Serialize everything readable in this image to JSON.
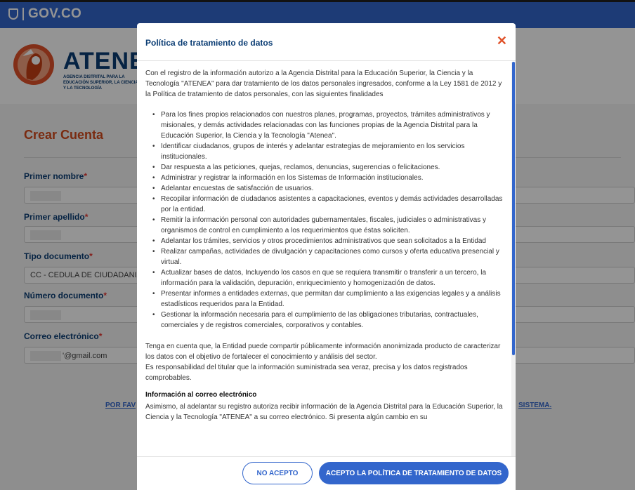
{
  "gov_bar": {
    "logo_text": "GOV.CO",
    "color": "#3366cc"
  },
  "brand": {
    "name": "ATENEA",
    "subtitle": "AGENCIA DISTRITAL PARA LA EDUCACIÓN SUPERIOR, LA CIENCIA Y LA TECNOLOGÍA",
    "primary_color": "#0b3d74",
    "accent_color": "#e0522a"
  },
  "form": {
    "title": "Crear Cuenta",
    "fields": [
      {
        "label": "Primer nombre",
        "value": ""
      },
      {
        "label": "Primer apellido",
        "value": ""
      },
      {
        "label": "Tipo documento",
        "value": "CC - CEDULA DE CIUDADANIA"
      },
      {
        "label": "Número documento",
        "value": ""
      },
      {
        "label": "Correo electrónico",
        "value": "'@gmail.com"
      }
    ],
    "required_mark": "*",
    "link_left": "POR FAV",
    "link_right": "SISTEMA."
  },
  "modal": {
    "title": "Política de tratamiento de datos",
    "close_icon": "close-icon",
    "intro": "Con el registro de la información autorizo a la Agencia Distrital para la Educación Superior, la Ciencia y la Tecnología \"ATENEA\" para dar tratamiento de los datos personales ingresados, conforme a la Ley 1581 de 2012 y la Política de tratamiento de datos personales, con las siguientes finalidades",
    "purposes": [
      "Para los fines propios relacionados con nuestros planes, programas, proyectos, trámites administrativos y misionales, y demás actividades relacionadas con las funciones propias de la Agencia Distrital para la Educación Superior, la Ciencia y la Tecnología \"Atenea\".",
      "Identificar ciudadanos, grupos de interés y adelantar estrategias de mejoramiento en los servicios institucionales.",
      "Dar respuesta a las peticiones, quejas, reclamos, denuncias, sugerencias o felicitaciones.",
      "Administrar y registrar la información en los Sistemas de Información institucionales.",
      "Adelantar encuestas de satisfacción de usuarios.",
      "Recopilar información de ciudadanos asistentes a capacitaciones, eventos y demás actividades desarrolladas por la entidad.",
      "Remitir la información personal con autoridades gubernamentales, fiscales, judiciales o administrativas y organismos de control en cumplimiento a los requerimientos que éstas soliciten.",
      "Adelantar los trámites, servicios y otros procedimientos administrativos que sean solicitados a la Entidad",
      "Realizar campañas, actividades de divulgación y capacitaciones como cursos y oferta educativa presencial y virtual.",
      "Actualizar bases de datos, Incluyendo los casos en que se requiera transmitir o transferir a un tercero, la información para la validación, depuración, enriquecimiento y homogenización de datos.",
      "Presentar informes a entidades externas, que permitan dar cumplimiento a las exigencias legales y a análisis estadísticos requeridos para la Entidad.",
      "Gestionar la información necesaria para el cumplimiento de las obligaciones tributarias, contractuales, comerciales y de registros comerciales, corporativos y contables."
    ],
    "note_1": "Tenga en cuenta que, la Entidad puede compartir públicamente información anonimizada producto de caracterizar los datos con el objetivo de fortalecer el conocimiento y análisis del sector.",
    "note_2": "Es responsabilidad del titular que la información suministrada sea veraz, precisa y los datos registrados comprobables.",
    "email_heading": "Información al correo electrónico",
    "email_text": "Asimismo, al adelantar su registro autoriza recibir información de la Agencia Distrital para la Educación Superior, la Ciencia y la Tecnología \"ATENEA\" a su correo electrónico. Si presenta algún cambio en su",
    "reject_label": "NO ACEPTO",
    "accept_label": "ACEPTO LA POLÍTICA DE TRATAMIENTO DE DATOS",
    "button_color": "#3366cc"
  }
}
